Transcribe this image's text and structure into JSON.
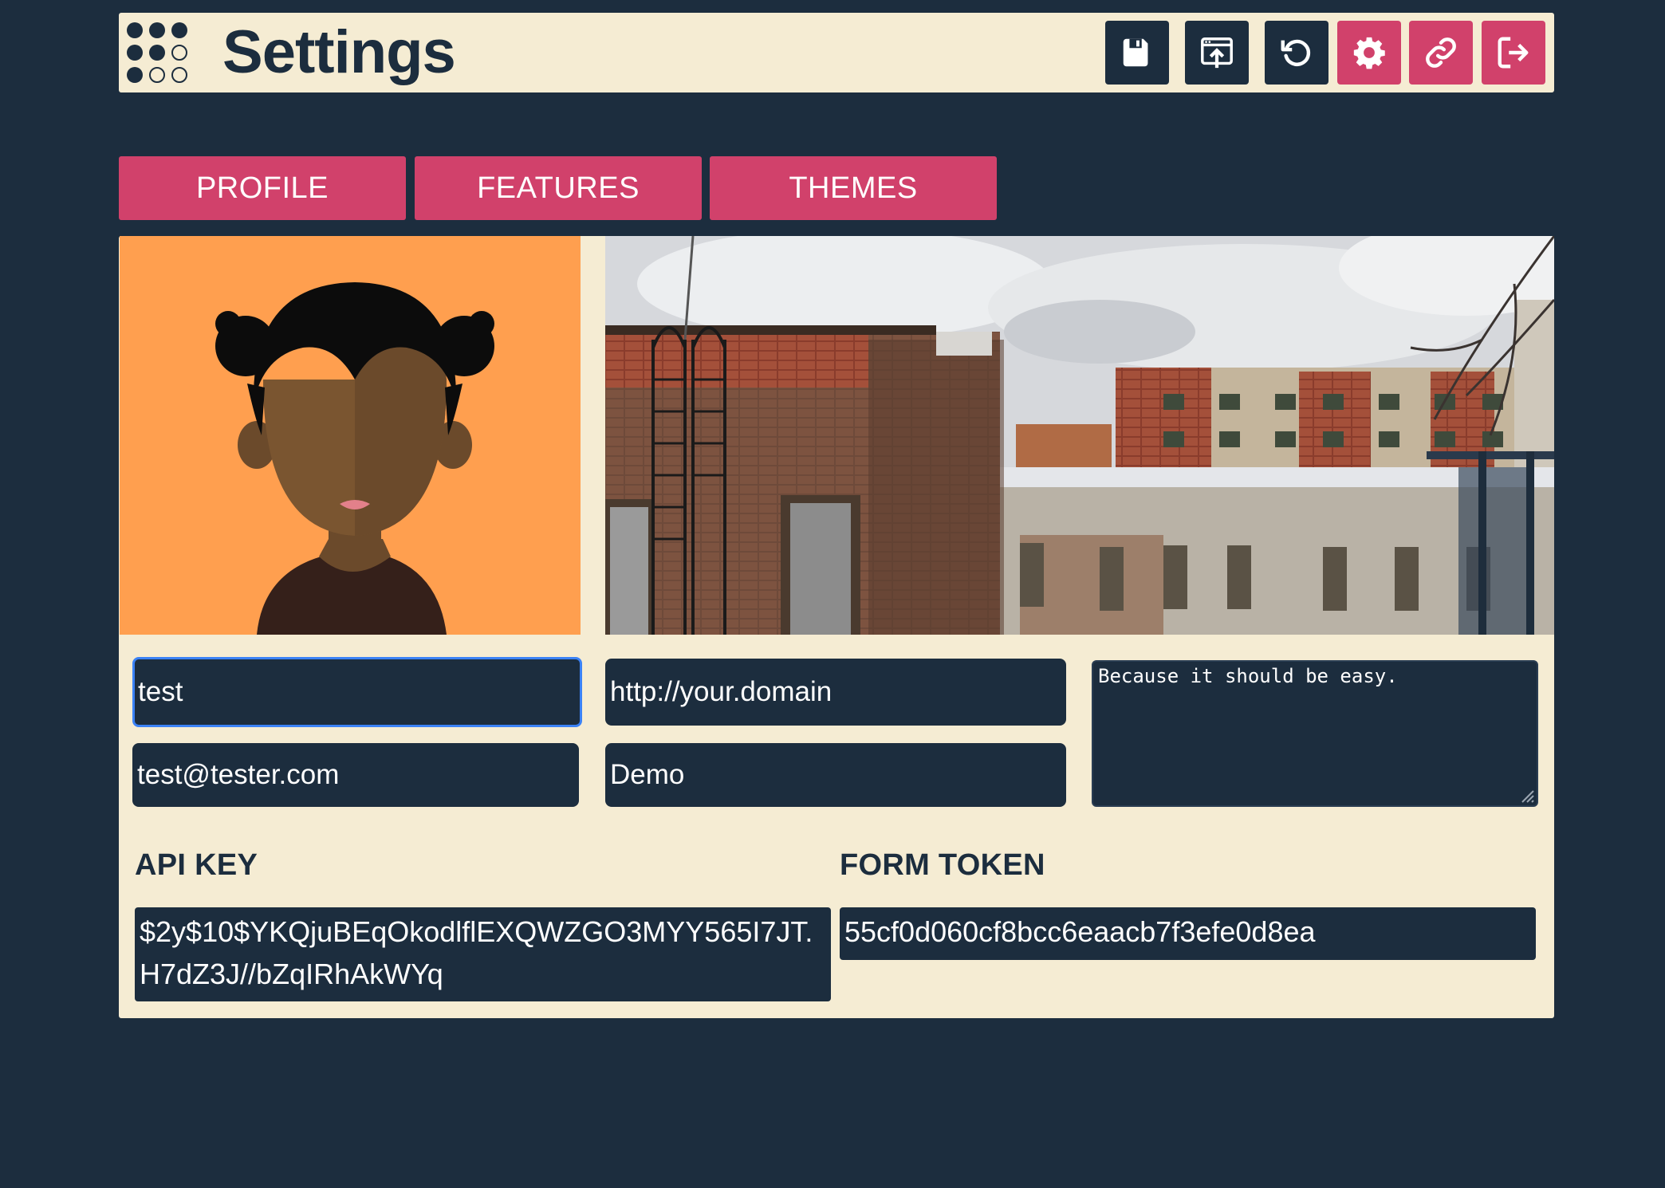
{
  "header": {
    "title": "Settings",
    "buttons": [
      {
        "name": "save-icon"
      },
      {
        "name": "upload-icon"
      },
      {
        "name": "refresh-icon"
      },
      {
        "name": "gear-icon"
      },
      {
        "name": "link-icon"
      },
      {
        "name": "logout-icon"
      }
    ]
  },
  "tabs": [
    {
      "label": "PROFILE"
    },
    {
      "label": "FEATURES"
    },
    {
      "label": "THEMES"
    }
  ],
  "profile": {
    "username": "test",
    "email": "test@tester.com",
    "website": "http://your.domain",
    "display_name": "Demo",
    "bio": "Because it should be easy."
  },
  "api_key": {
    "label": "API KEY",
    "value": "$2y$10$YKQjuBEqOkodlflEXQWZGO3MYY565I7JT.H7dZ3J//bZqIRhAkWYq"
  },
  "form_token": {
    "label": "FORM TOKEN",
    "value": "55cf0d060cf8bcc6eaacb7f3efe0d8ea"
  },
  "colors": {
    "background": "#1c2d3e",
    "panel": "#f5ecd3",
    "accent": "#d1416b",
    "avatar_bg": "#ff9f4f"
  }
}
